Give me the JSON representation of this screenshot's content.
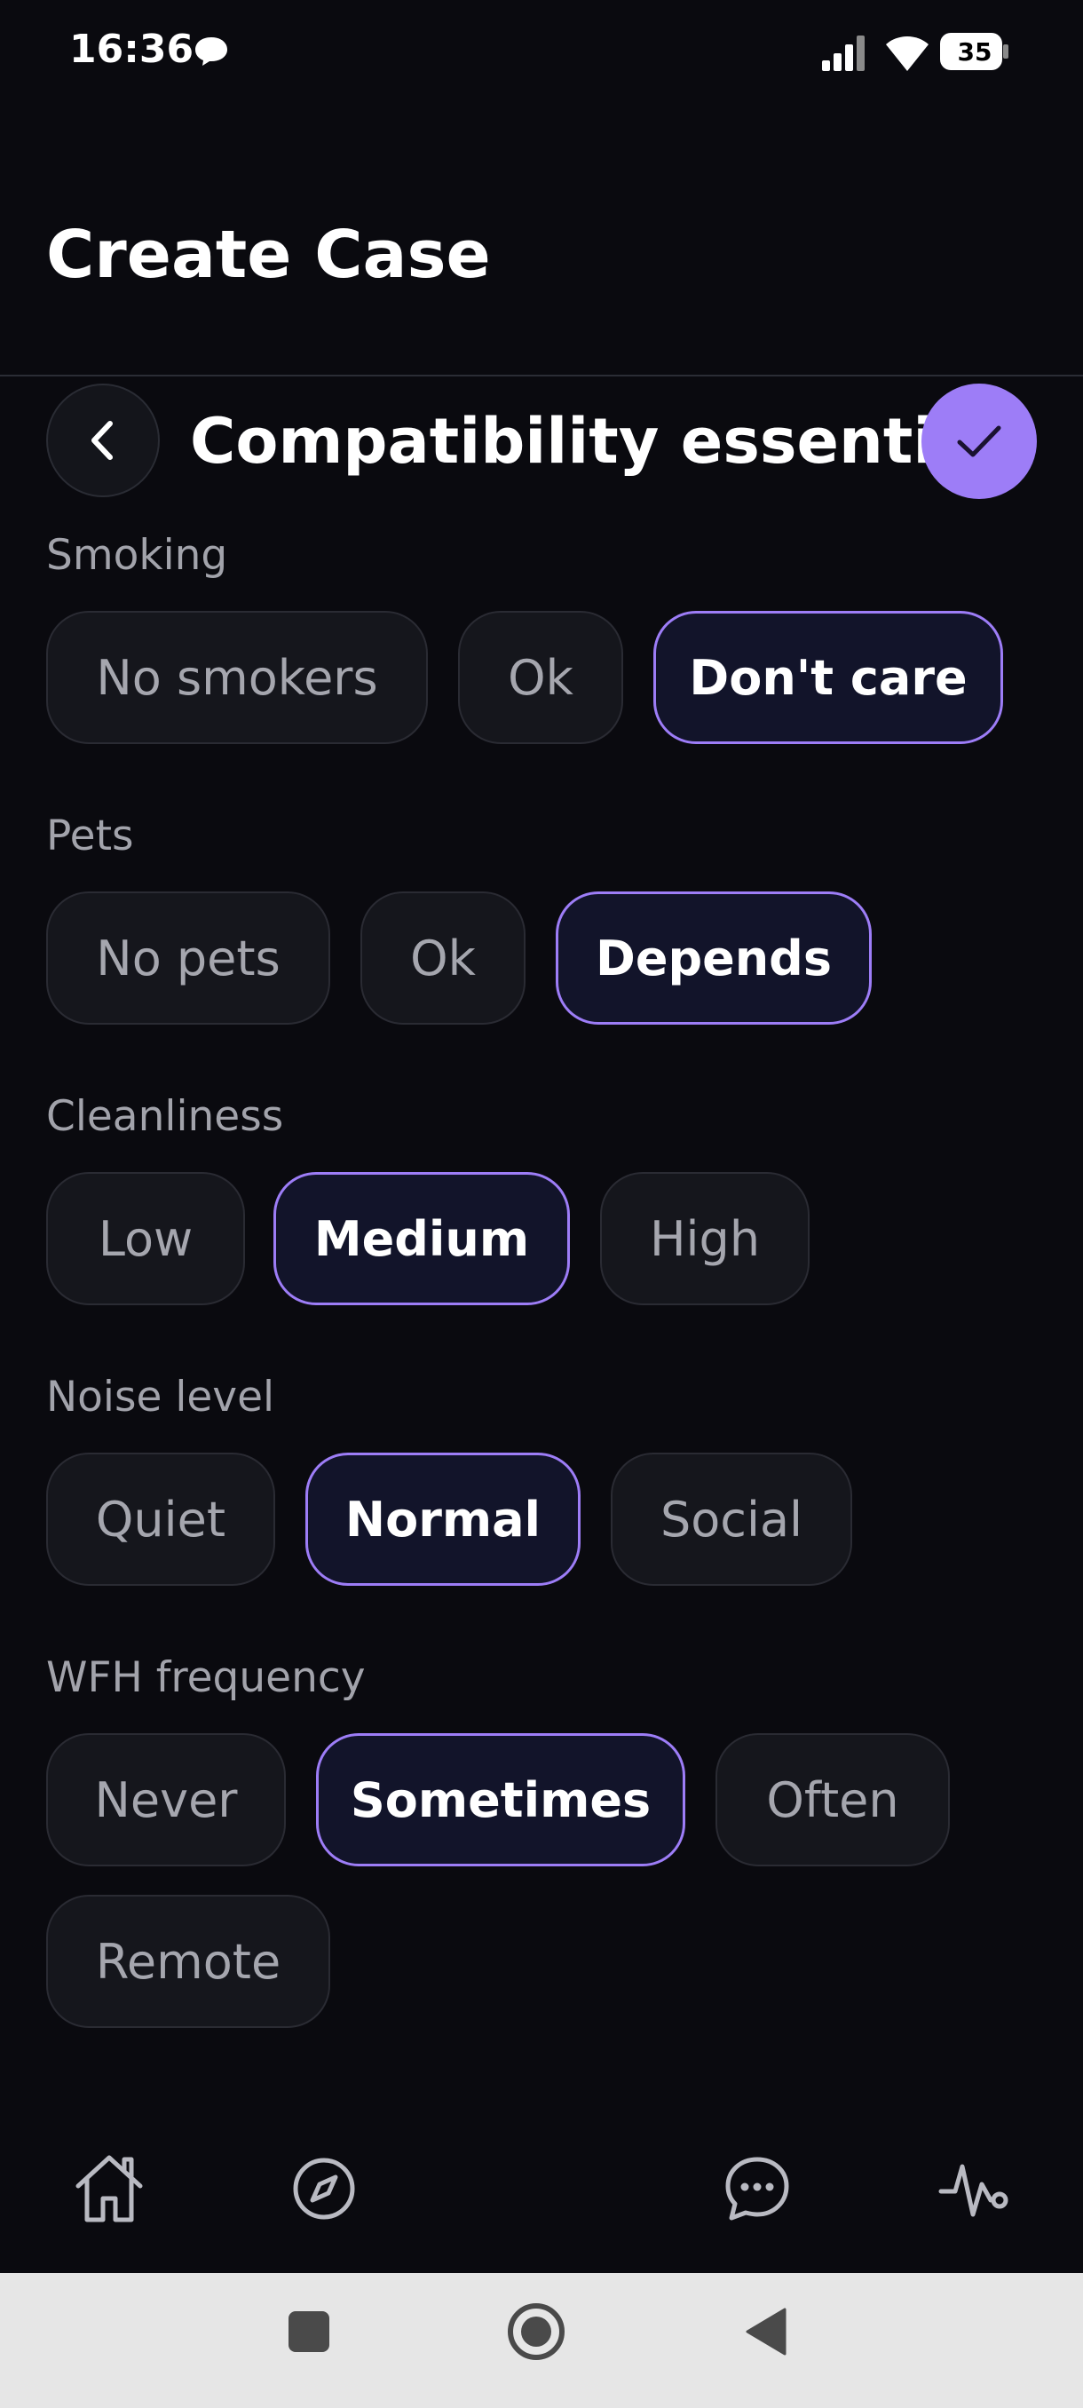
{
  "status_bar": {
    "time": "16:36",
    "battery_level": "35",
    "icons": [
      "chat-bubble-icon",
      "signal-icon",
      "wifi-icon",
      "battery-icon"
    ]
  },
  "page_title": "Create Case",
  "section": {
    "title": "Compatibility essentials",
    "back_icon": "chevron-left-icon",
    "confirm_icon": "check-icon"
  },
  "groups": [
    {
      "label": "Smoking",
      "options": [
        "No smokers",
        "Ok",
        "Don't care"
      ],
      "selected": "Don't care"
    },
    {
      "label": "Pets",
      "options": [
        "No pets",
        "Ok",
        "Depends"
      ],
      "selected": "Depends"
    },
    {
      "label": "Cleanliness",
      "options": [
        "Low",
        "Medium",
        "High"
      ],
      "selected": "Medium"
    },
    {
      "label": "Noise level",
      "options": [
        "Quiet",
        "Normal",
        "Social"
      ],
      "selected": "Normal"
    },
    {
      "label": "WFH frequency",
      "options": [
        "Never",
        "Sometimes",
        "Often",
        "Remote"
      ],
      "selected": "Sometimes"
    }
  ],
  "bottom_nav": {
    "items": [
      "home-icon",
      "compass-icon",
      "chat-icon",
      "activity-icon"
    ]
  },
  "system_nav": {
    "items": [
      "recents-square-icon",
      "home-circle-icon",
      "back-triangle-icon"
    ]
  },
  "colors": {
    "background": "#0a0a0f",
    "accent": "#9d7df7",
    "chip_bg": "#15161c",
    "chip_selected_bg": "#12142a",
    "label": "#a2a3ab"
  }
}
